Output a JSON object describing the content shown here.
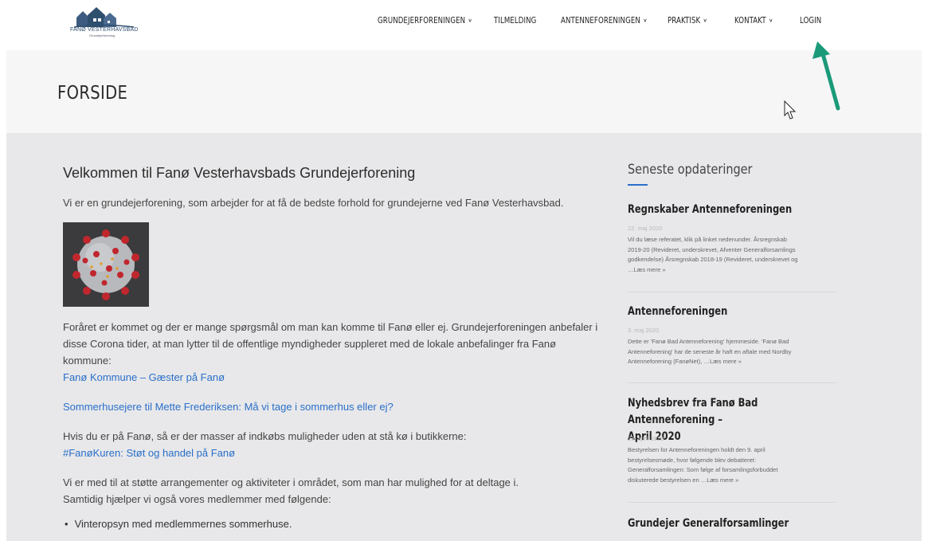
{
  "header": {
    "logo_text": "FANØ VESTERHAVSBAD",
    "logo_sub": "Grundejerforening",
    "nav": [
      {
        "label": "GRUNDEJERFORENINGEN",
        "has_dropdown": true
      },
      {
        "label": "TILMELDING",
        "has_dropdown": false
      },
      {
        "label": "ANTENNEFORENINGEN",
        "has_dropdown": true
      },
      {
        "label": "PRAKTISK",
        "has_dropdown": true
      },
      {
        "label": "KONTAKT",
        "has_dropdown": true
      },
      {
        "label": "LOGIN",
        "has_dropdown": false
      }
    ]
  },
  "page": {
    "title": "FORSIDE"
  },
  "main": {
    "heading": "Velkommen til Fanø Vesterhavsbads Grundejerforening",
    "intro": "Vi er en grundejerforening, som arbejder for at få de bedste forhold for grundejerne ved Fanø Vesterhavsbad.",
    "para1_line1": "Foråret er kommet og der er mange spørgsmål om man kan komme til Fanø eller ej. Grundejerforeningen anbefaler i",
    "para1_line2": "disse Corona tider, at man lytter til de offentlige myndigheder suppleret med de lokale anbefalinger fra Fanø",
    "para1_line3": "kommune:",
    "link1": "Fanø Kommune – Gæster på Fanø",
    "link2": "Sommerhusejere til Mette Frederiksen: Må vi tage i sommerhus eller ej?",
    "para2": "Hvis du er på Fanø, så er der masser af indkøbs muligheder uden at stå kø i butikkerne:",
    "link3": "#FanøKuren: Støt og handel på Fanø",
    "para3_line1": "Vi er med til at støtte arrangementer og aktiviteter i området, som man har mulighed for at deltage i.",
    "para3_line2": "Samtidig hjælper vi også vores medlemmer med følgende:",
    "bullets": [
      "Vinteropsyn med medlemmernes sommerhuse."
    ]
  },
  "sidebar": {
    "heading": "Seneste opdateringer",
    "posts": [
      {
        "title": "Regnskaber Antenneforeningen",
        "date": "22. maj 2020",
        "excerpt_lines": [
          "Vil du læse referatet, klik på linket nedenunder. Årsregnskab",
          "2019-20 (Revideret, underskrevet, Afventer Generalforsamlings",
          "godkendelse) Årsregnskab 2018-19 (Revideret, underskrevet og",
          "…Læs mere »"
        ]
      },
      {
        "title": "Antenneforeningen",
        "date": "3. maj 2020",
        "excerpt_lines": [
          "Dette er 'Fanø Bad Antenneforening' hjemmeside. 'Fanø Bad",
          "Antenneforening' har de seneste år haft en aftale med Nordby",
          "Antenneforening (FanøNet), …Læs mere »"
        ]
      },
      {
        "title_line1": "Nyhedsbrev fra Fanø Bad Antenneforening –",
        "title_line2": "April 2020",
        "date": "23. april 2020",
        "excerpt_lines": [
          "Bestyrelsen for Antenneforeningen holdt den 9. april",
          "bestyrelsesmøde, hvor følgende blev debatteret:",
          "Generalforsamlingen: Som følge af forsamlingsforbuddet",
          "diskuterede bestyrelsen en …Læs mere »"
        ]
      },
      {
        "title": "Grundejer Generalforsamlinger"
      }
    ]
  },
  "colors": {
    "link": "#2a6fc9",
    "annotation_arrow": "#1a9a78",
    "content_bg": "#e8e8ea"
  }
}
